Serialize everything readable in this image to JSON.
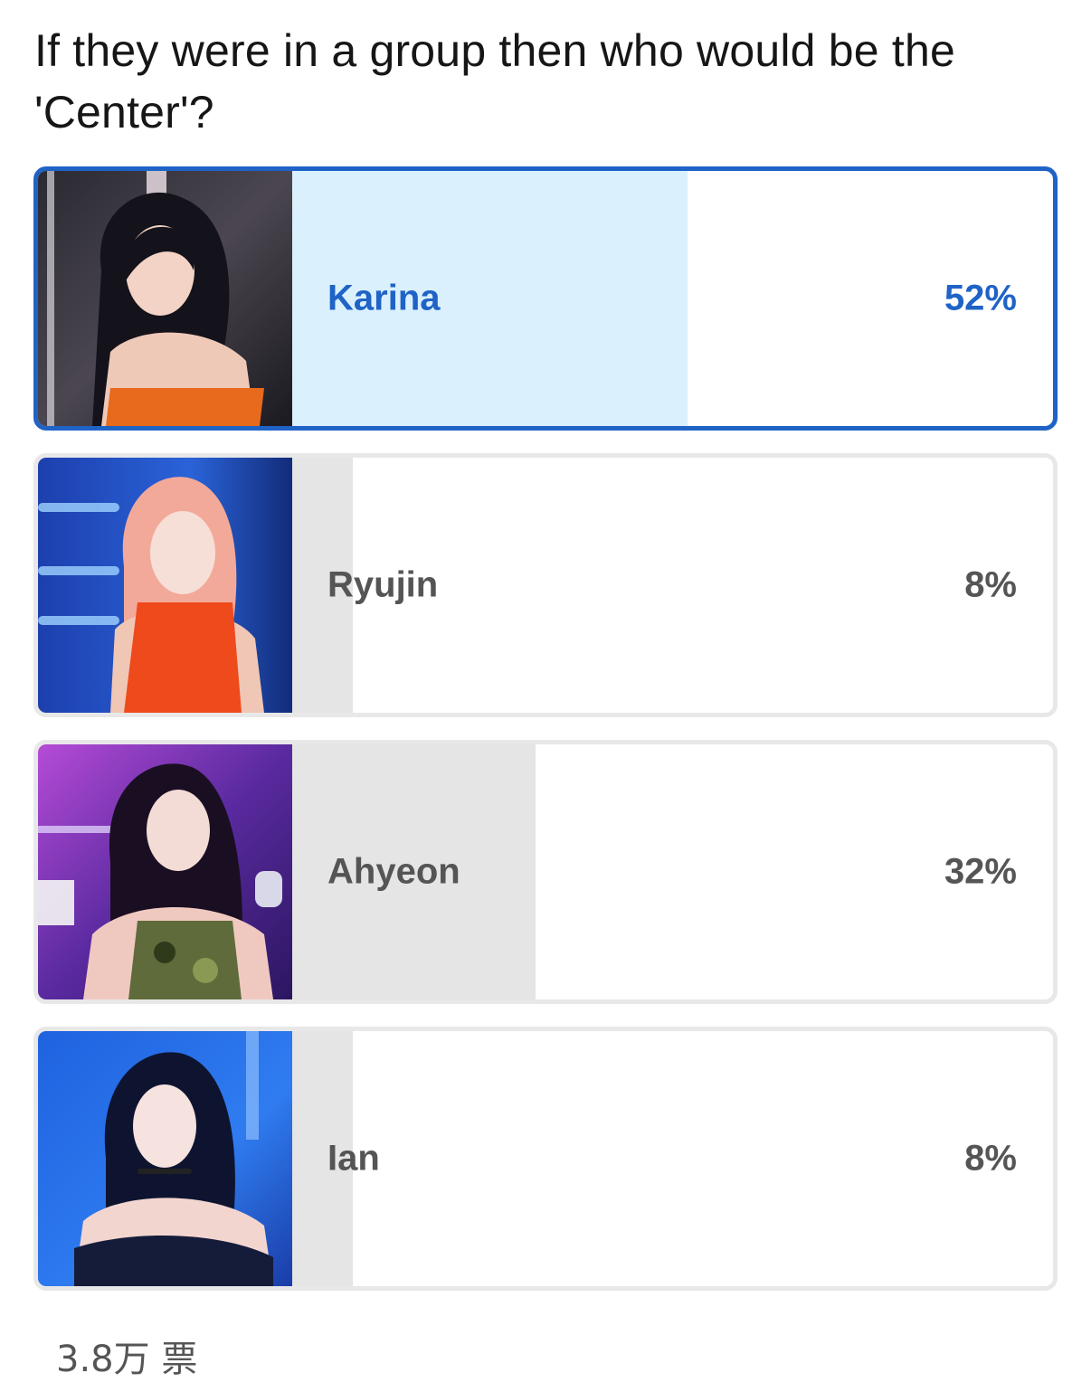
{
  "poll": {
    "question": "If they were in a group then who would be the 'Center'?",
    "options": [
      {
        "label": "Karina",
        "percent_text": "52%",
        "percent": 52,
        "selected": true
      },
      {
        "label": "Ryujin",
        "percent_text": "8%",
        "percent": 8,
        "selected": false
      },
      {
        "label": "Ahyeon",
        "percent_text": "32%",
        "percent": 32,
        "selected": false
      },
      {
        "label": "Ian",
        "percent_text": "8%",
        "percent": 8,
        "selected": false
      }
    ],
    "vote_count": "3.8万 票"
  },
  "colors": {
    "accent": "#1f63c6",
    "selected_fill": "#daf0fd",
    "bar_fill": "#e5e5e5",
    "border": "#e8e8e8"
  }
}
